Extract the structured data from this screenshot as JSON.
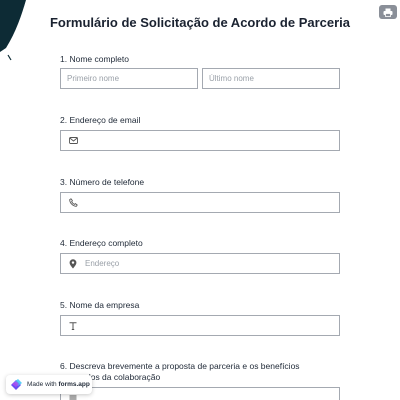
{
  "form": {
    "title": "Formulário de Solicitação de Acordo de Parceria"
  },
  "fields": {
    "name": {
      "label": "1. Nome completo",
      "first_placeholder": "Primeiro nome",
      "last_placeholder": "Último nome"
    },
    "email": {
      "label": "2. Endereço de email",
      "icon": "mail-icon"
    },
    "phone": {
      "label": "3. Número de telefone",
      "icon": "phone-icon"
    },
    "address": {
      "label": "4. Endereço completo",
      "icon": "location-pin-icon",
      "placeholder": "Endereço"
    },
    "company": {
      "label": "5. Nome da empresa",
      "icon": "text-icon"
    },
    "proposal": {
      "label": "6. Descreva brevemente a proposta de parceria e os benefícios esperados da colaboração",
      "icon": "text-lines-icon"
    }
  },
  "badge": {
    "prefix": "Made with",
    "brand": "forms.app"
  },
  "colors": {
    "border": "#a4a9b1",
    "title": "#1a2230",
    "placeholder": "#9aa0a8",
    "badge_logo": "#6a4ff2"
  }
}
